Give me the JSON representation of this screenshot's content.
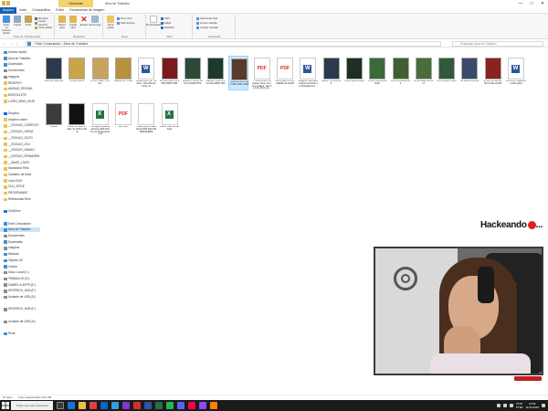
{
  "window": {
    "title": "Área de Trabalho",
    "context_tab": "Gerenciar",
    "minimize": "—",
    "maximize": "□",
    "close": "✕"
  },
  "ribbon_tabs": [
    {
      "label": "Arquivo",
      "active": true
    },
    {
      "label": "Início",
      "active": false
    },
    {
      "label": "Compartilhar",
      "active": false
    },
    {
      "label": "Exibir",
      "active": false
    },
    {
      "label": "Ferramentas de Imagem",
      "active": false
    }
  ],
  "ribbon": {
    "clipboard": {
      "group_label": "Área de Transferência",
      "pin": "Fixar no Acesso rápido",
      "copy": "Copiar",
      "paste": "Colar",
      "cut": "Recortar",
      "copy_path": "Copiar caminho",
      "paste_shortcut": "Colar atalho"
    },
    "organize": {
      "group_label": "Organizar",
      "move_to": "Mover para",
      "copy_to": "Copiar para",
      "delete": "Excluir",
      "rename": "Renomear"
    },
    "new": {
      "group_label": "Novo",
      "new_folder": "Nova pasta",
      "new_item": "Novo item",
      "easy_access": "Fácil acesso"
    },
    "open": {
      "group_label": "Abrir",
      "properties": "Propriedades",
      "open": "Abrir",
      "edit": "Editar",
      "history": "Histórico"
    },
    "select": {
      "group_label": "Selecionar",
      "select_all": "Selecionar tudo",
      "select_none": "Limpar seleção",
      "invert": "Inverter seleção"
    }
  },
  "address": {
    "back": "←",
    "forward": "→",
    "up": "↑",
    "path": "› Este Computador › Área de Trabalho",
    "search_placeholder": "Pesquisar Área de Trabalho"
  },
  "nav_pane": [
    {
      "label": "Acesso rápido",
      "chev": "⌄",
      "color": "#3b8fd4",
      "sel": false
    },
    {
      "label": "Área de Trabalho",
      "chev": "",
      "color": "#3b8fd4",
      "sel": false
    },
    {
      "label": "Downloads",
      "chev": "",
      "color": "#3b8fd4",
      "sel": false
    },
    {
      "label": "Documentos",
      "chev": "",
      "color": "#8a8a8a",
      "sel": false
    },
    {
      "label": "Imagens",
      "chev": "",
      "color": "#8a8a8a",
      "sel": false
    },
    {
      "label": "RESERVY",
      "chev": "",
      "color": "#e8c35a",
      "sel": false
    },
    {
      "label": "AMIGAS_REGINA",
      "chev": "",
      "color": "#e8c35a",
      "sel": false
    },
    {
      "label": "BISSOCLETE",
      "chev": "",
      "color": "#e8c35a",
      "sel": false
    },
    {
      "label": "LIVRO_NEW_HOJE",
      "chev": "",
      "color": "#e8c35a",
      "sel": false
    },
    {
      "label": "",
      "chev": "",
      "color": "",
      "sel": false
    },
    {
      "label": "Dropbox",
      "chev": "›",
      "color": "#0061fe",
      "sel": false
    },
    {
      "label": "dropbox cache",
      "chev": "",
      "color": "#e8c35a",
      "sel": false
    },
    {
      "label": "__EDICAO_COMPLEO",
      "chev": "›",
      "color": "#e8c35a",
      "sel": false
    },
    {
      "label": "__EDICAO_GEISA",
      "chev": "›",
      "color": "#e8c35a",
      "sel": false
    },
    {
      "label": "__EDICAO_GUTO",
      "chev": "›",
      "color": "#e8c35a",
      "sel": false
    },
    {
      "label": "__EDICAO_JOU",
      "chev": "›",
      "color": "#e8c35a",
      "sel": false
    },
    {
      "label": "__EDICAO_NADAO",
      "chev": "›",
      "color": "#e8c35a",
      "sel": false
    },
    {
      "label": "__EDICAO_REINAMEN",
      "chev": "›",
      "color": "#e8c35a",
      "sel": false
    },
    {
      "label": "__BASE_LIVES",
      "chev": "›",
      "color": "#e8c35a",
      "sel": false
    },
    {
      "label": "Ilustradora Reto",
      "chev": "›",
      "color": "#e8c35a",
      "sel": false
    },
    {
      "label": "Cadastro de fotos",
      "chev": "›",
      "color": "#e8c35a",
      "sel": false
    },
    {
      "label": "Lives 2020",
      "chev": "›",
      "color": "#e8c35a",
      "sel": false
    },
    {
      "label": "OLD_SPICE",
      "chev": "›",
      "color": "#e8c35a",
      "sel": false
    },
    {
      "label": "PROGRAMAS",
      "chev": "›",
      "color": "#e8c35a",
      "sel": false
    },
    {
      "label": "Referencias Reto",
      "chev": "›",
      "color": "#e8c35a",
      "sel": false
    },
    {
      "label": "",
      "chev": "",
      "color": "",
      "sel": false
    },
    {
      "label": "OneDrive",
      "chev": "›",
      "color": "#1e77d4",
      "sel": false
    },
    {
      "label": "",
      "chev": "",
      "color": "",
      "sel": false
    },
    {
      "label": "Este Computador",
      "chev": "⌄",
      "color": "#3b8fd4",
      "sel": false
    },
    {
      "label": "Área de Trabalho",
      "chev": "›",
      "color": "#3b8fd4",
      "sel": true
    },
    {
      "label": "Documentos",
      "chev": "›",
      "color": "#8a8a8a",
      "sel": false
    },
    {
      "label": "Downloads",
      "chev": "›",
      "color": "#3b8fd4",
      "sel": false
    },
    {
      "label": "Imagens",
      "chev": "›",
      "color": "#8a8a8a",
      "sel": false
    },
    {
      "label": "Músicas",
      "chev": "›",
      "color": "#3b8fd4",
      "sel": false
    },
    {
      "label": "Objetos 3D",
      "chev": "›",
      "color": "#3b8fd4",
      "sel": false
    },
    {
      "label": "Vídeos",
      "chev": "›",
      "color": "#3b8fd4",
      "sel": false
    },
    {
      "label": "Disco Local (C:)",
      "chev": "›",
      "color": "#8a8a8a",
      "sel": false
    },
    {
      "label": "TRABALHO (D:)",
      "chev": "›",
      "color": "#8a8a8a",
      "sel": false
    },
    {
      "label": "GAMES & APPS (E:)",
      "chev": "›",
      "color": "#8a8a8a",
      "sel": false
    },
    {
      "label": "DROPBOX_HUB (F:)",
      "chev": "›",
      "color": "#8a8a8a",
      "sel": false
    },
    {
      "label": "Unidade de USB (G:)",
      "chev": "›",
      "color": "#8a8a8a",
      "sel": false
    },
    {
      "label": "",
      "chev": "",
      "color": "",
      "sel": false
    },
    {
      "label": "DROPBOX_HUB (F:)",
      "chev": "›",
      "color": "#8a8a8a",
      "sel": false
    },
    {
      "label": "",
      "chev": "",
      "color": "",
      "sel": false
    },
    {
      "label": "Unidade de USB (G:)",
      "chev": "›",
      "color": "#8a8a8a",
      "sel": false
    },
    {
      "label": "",
      "chev": "",
      "color": "",
      "sel": false
    },
    {
      "label": "Rede",
      "chev": "›",
      "color": "#3b8fd4",
      "sel": false
    }
  ],
  "files": [
    {
      "name": "AMONG_REGINA",
      "type": "img",
      "color": "#2b3a4a"
    },
    {
      "name": "BISSOCLETE",
      "type": "img",
      "color": "#c9a54a"
    },
    {
      "name": "LIVRO_NEW_HOJE 1",
      "type": "img",
      "color": "#caa45e"
    },
    {
      "name": "MEDALHO HOJE",
      "type": "img",
      "color": "#b8903e"
    },
    {
      "name": "[DIGE] New Set Trailerle - Reto Borrachudo_01",
      "type": "doc",
      "color": ""
    },
    {
      "name": "b1f1df9f e0b8 4f8 a8b9-5f0f3b 46f4",
      "type": "img",
      "color": "#7a1a1a"
    },
    {
      "name": "2fa60947-4f09-4 b9f0-bf 4004b 8f7fb",
      "type": "img",
      "color": "#2c4a3a"
    },
    {
      "name": "2fa60947-4f09-4 0f9-b7d4-2600f 1f9b",
      "type": "img",
      "color": "#1f3a2c"
    },
    {
      "name": "43ad18e 2f62 40e b 9f6c 0f0f1 40f2b",
      "type": "img",
      "color": "#5a3a2a",
      "selected": true
    },
    {
      "name": "Y74422 ETEC G3 Cartao Jesse LG novo vestibul_Trueme Instl_Nrpu_Ve...",
      "type": "pdf",
      "color": ""
    },
    {
      "name": "DOCUMENTO DO CARRO ALUGAR",
      "type": "pdf",
      "color": ""
    },
    {
      "name": "Designer Milenquela Drive Curriculo de Produção de L...",
      "type": "doc",
      "color": ""
    },
    {
      "name": "BANDYNOVOAN19",
      "type": "img",
      "color": "#2a3a4c"
    },
    {
      "name": "DHRPSBK4UIMQ8",
      "type": "img",
      "color": "#1e2e22"
    },
    {
      "name": "DHRP0 BFNMVM Ditch",
      "type": "img",
      "color": "#3a6a3a"
    },
    {
      "name": "DHRPS8N6MBKSJ2",
      "type": "img",
      "color": "#3f5f30"
    },
    {
      "name": "DHRPSB6WM8 Mtnz",
      "type": "img",
      "color": "#4a6b3a"
    },
    {
      "name": "DHRPSB4ZY0G28",
      "type": "img",
      "color": "#2f5a3c"
    },
    {
      "name": "ao sacole imenski",
      "type": "img",
      "color": "#3a4a6a"
    },
    {
      "name": "f0f 4f0f 2a 3fef-44 f0bf bf-4fa e6 bf0f",
      "type": "img",
      "color": "#8a2222"
    },
    {
      "name": "FASHOO Pagamento Diru ghos",
      "type": "doc",
      "color": ""
    },
    {
      "name": "invoker",
      "type": "img",
      "color": "#3b3b3b"
    },
    {
      "name": "Pirates of Silicon Valley 4x-2160 et Dual",
      "type": "img",
      "color": "#111111"
    },
    {
      "name": "cronograma planejamento 2020 Abril 01_21 25 Novembro 02",
      "type": "xls",
      "color": ""
    },
    {
      "name": "Bill_PAID",
      "type": "pdf",
      "color": ""
    },
    {
      "name": "VIDEO_ENCODER Heat Add0 Pileti AEM60NA4EBA",
      "type": "txt",
      "color": ""
    },
    {
      "name": "Videos Reto Borrachudo",
      "type": "xls",
      "color": ""
    }
  ],
  "overlay": {
    "brand": "Hackeando",
    "brand_tail": "..."
  },
  "status": {
    "item_count": "27 itens",
    "selection": "1 item selecionado 19,3 KB"
  },
  "taskbar": {
    "search_placeholder": "Digite aqui para pesquisar",
    "lang_top": "POR",
    "lang_bottom": "PTB2",
    "time": "12:59",
    "date": "11/11/2020"
  }
}
